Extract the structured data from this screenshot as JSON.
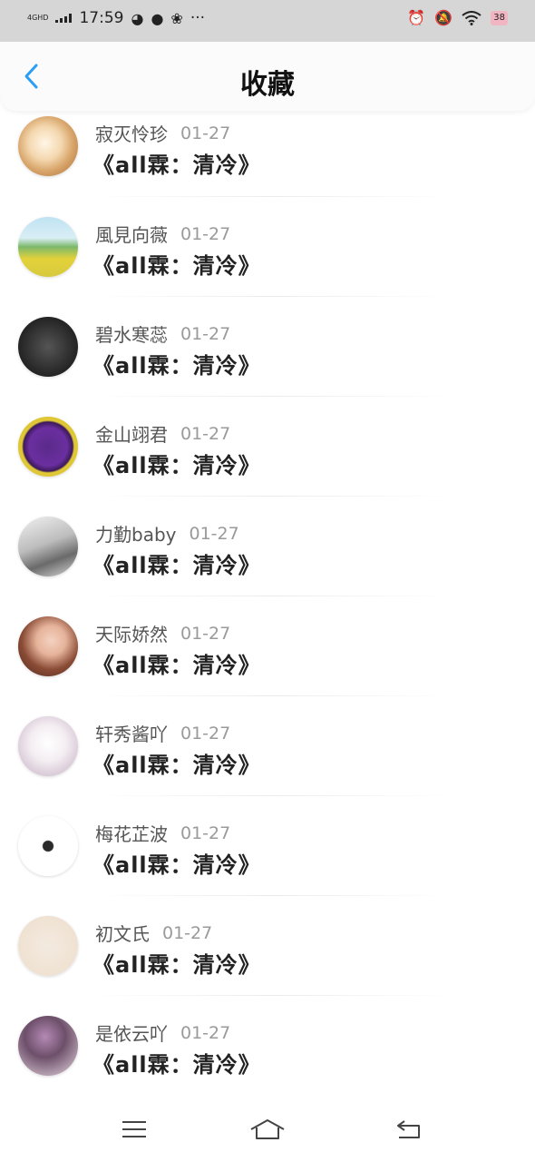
{
  "status_bar": {
    "network": "4GHD",
    "time": "17:59",
    "more": "···",
    "battery": "38"
  },
  "header": {
    "title": "收藏",
    "back_icon": "chevron-left-icon"
  },
  "favorites": [
    {
      "name": "寂灭怜珍",
      "date": "01-27",
      "title": "《all霖：清冷》",
      "avatar": "seashell"
    },
    {
      "name": "風見向薇",
      "date": "01-27",
      "title": "《all霖：清冷》",
      "avatar": "landscape"
    },
    {
      "name": "碧水寒蕊",
      "date": "01-27",
      "title": "《all霖：清冷》",
      "avatar": "dark-text"
    },
    {
      "name": "金山翊君",
      "date": "01-27",
      "title": "《all霖：清冷》",
      "avatar": "purple-badge"
    },
    {
      "name": "力勤baby",
      "date": "01-27",
      "title": "《all霖：清冷》",
      "avatar": "bw-photo"
    },
    {
      "name": "天际娇然",
      "date": "01-27",
      "title": "《all霖：清冷》",
      "avatar": "girl-photo"
    },
    {
      "name": "轩秀酱吖",
      "date": "01-27",
      "title": "《all霖：清冷》",
      "avatar": "anime-bunny"
    },
    {
      "name": "梅花芷波",
      "date": "01-27",
      "title": "《all霖：清冷》",
      "avatar": "tiny-figure"
    },
    {
      "name": "初文氏",
      "date": "01-27",
      "title": "《all霖：清冷》",
      "avatar": "beige"
    },
    {
      "name": "是依云吖",
      "date": "01-27",
      "title": "《all霖：清冷》",
      "avatar": "person-photo"
    }
  ],
  "bottom_nav": [
    "menu-icon",
    "home-icon",
    "back-icon"
  ],
  "colors": {
    "accent": "#2a9df4",
    "status_bar_bg": "#d6d6d6",
    "name_text": "#555555",
    "date_text": "#9a9a9a",
    "title_text": "#222222"
  }
}
